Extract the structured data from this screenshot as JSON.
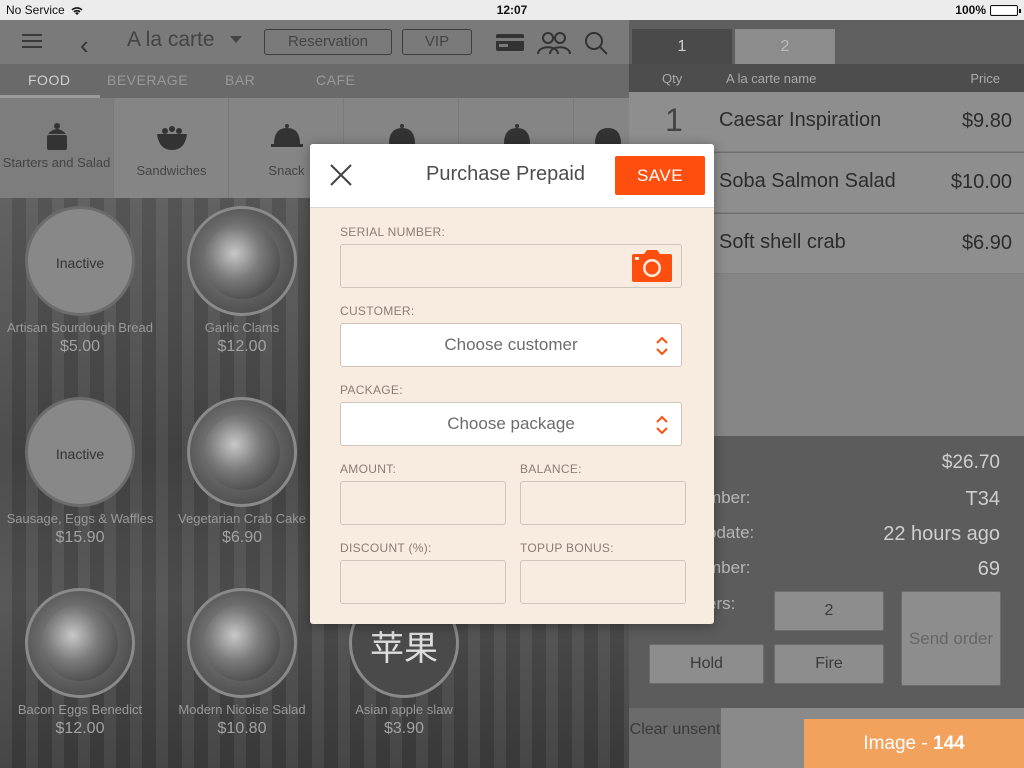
{
  "status": {
    "carrier": "No Service",
    "time": "12:07",
    "battery": "100%"
  },
  "topbar": {
    "title": "A la carte",
    "reservation_label": "Reservation",
    "vip_label": "VIP"
  },
  "categories": [
    {
      "label": "FOOD",
      "active": true
    },
    {
      "label": "BEVERAGE",
      "active": false
    },
    {
      "label": "BAR",
      "active": false
    },
    {
      "label": "CAFE",
      "active": false
    }
  ],
  "subcategories": [
    {
      "label": "Starters and Salad",
      "icon": "cake-icon",
      "selected": true
    },
    {
      "label": "Sandwiches",
      "icon": "salad-bowl-icon",
      "selected": false
    },
    {
      "label": "Snack",
      "icon": "cloche-icon",
      "selected": false
    },
    {
      "label": "",
      "icon": "cloche-icon",
      "selected": false
    },
    {
      "label": "",
      "icon": "cloche-icon",
      "selected": false
    }
  ],
  "menu_items": [
    {
      "name": "Artisan Sourdough Bread",
      "price": "$5.00",
      "inactive_text": "Inactive"
    },
    {
      "name": "Garlic Clams",
      "price": "$12.00",
      "inactive_text": ""
    },
    {
      "name": "Sausage, Eggs & Waffles",
      "price": "$15.90",
      "inactive_text": "Inactive"
    },
    {
      "name": "Vegetarian Crab Cake",
      "price": "$6.90",
      "inactive_text": ""
    },
    {
      "name": "Bacon Eggs Benedict",
      "price": "$12.00",
      "inactive_text": ""
    },
    {
      "name": "Modern Nicoise Salad",
      "price": "$10.80",
      "inactive_text": ""
    },
    {
      "name": "Asian apple slaw",
      "price": "$3.90",
      "inactive_text": "",
      "glyph": "苹果"
    }
  ],
  "order": {
    "tabs": [
      "1",
      "2"
    ],
    "headers": {
      "qty": "Qty",
      "name": "A la carte name",
      "price": "Price"
    },
    "rows": [
      {
        "qty": "1",
        "name": "Caesar Inspiration",
        "price": "$9.80"
      },
      {
        "qty": "",
        "name": "Soba Salmon Salad",
        "price": "$10.00"
      },
      {
        "qty": "",
        "name": "Soft shell crab",
        "price": "$6.90"
      }
    ],
    "total": "$26.70",
    "summary": [
      {
        "label": "mber:",
        "value": "T34"
      },
      {
        "label": "pdate:",
        "value": "22 hours ago"
      },
      {
        "label": "mber:",
        "value": "69"
      },
      {
        "label": "ers:",
        "value": ""
      }
    ],
    "guests_value": "2",
    "send_order_label": "Send order",
    "hold_label": "Hold",
    "fire_label": "Fire",
    "clear_label": "Clear unsent"
  },
  "badge": {
    "prefix": "Image - ",
    "number": "144"
  },
  "modal": {
    "title": "Purchase Prepaid",
    "save_label": "SAVE",
    "serial_label": "SERIAL NUMBER:",
    "serial_value": "",
    "customer_label": "CUSTOMER:",
    "customer_placeholder": "Choose customer",
    "package_label": "PACKAGE:",
    "package_placeholder": "Choose package",
    "amount_label": "AMOUNT:",
    "amount_value": "",
    "balance_label": "BALANCE:",
    "balance_value": "",
    "discount_label": "DISCOUNT (%):",
    "discount_value": "",
    "topup_label": "TOPUP BONUS:",
    "topup_value": ""
  },
  "colors": {
    "accent": "#ff4f0e",
    "modal_bg": "#f8ebe0",
    "badge": "#f2a25c"
  }
}
